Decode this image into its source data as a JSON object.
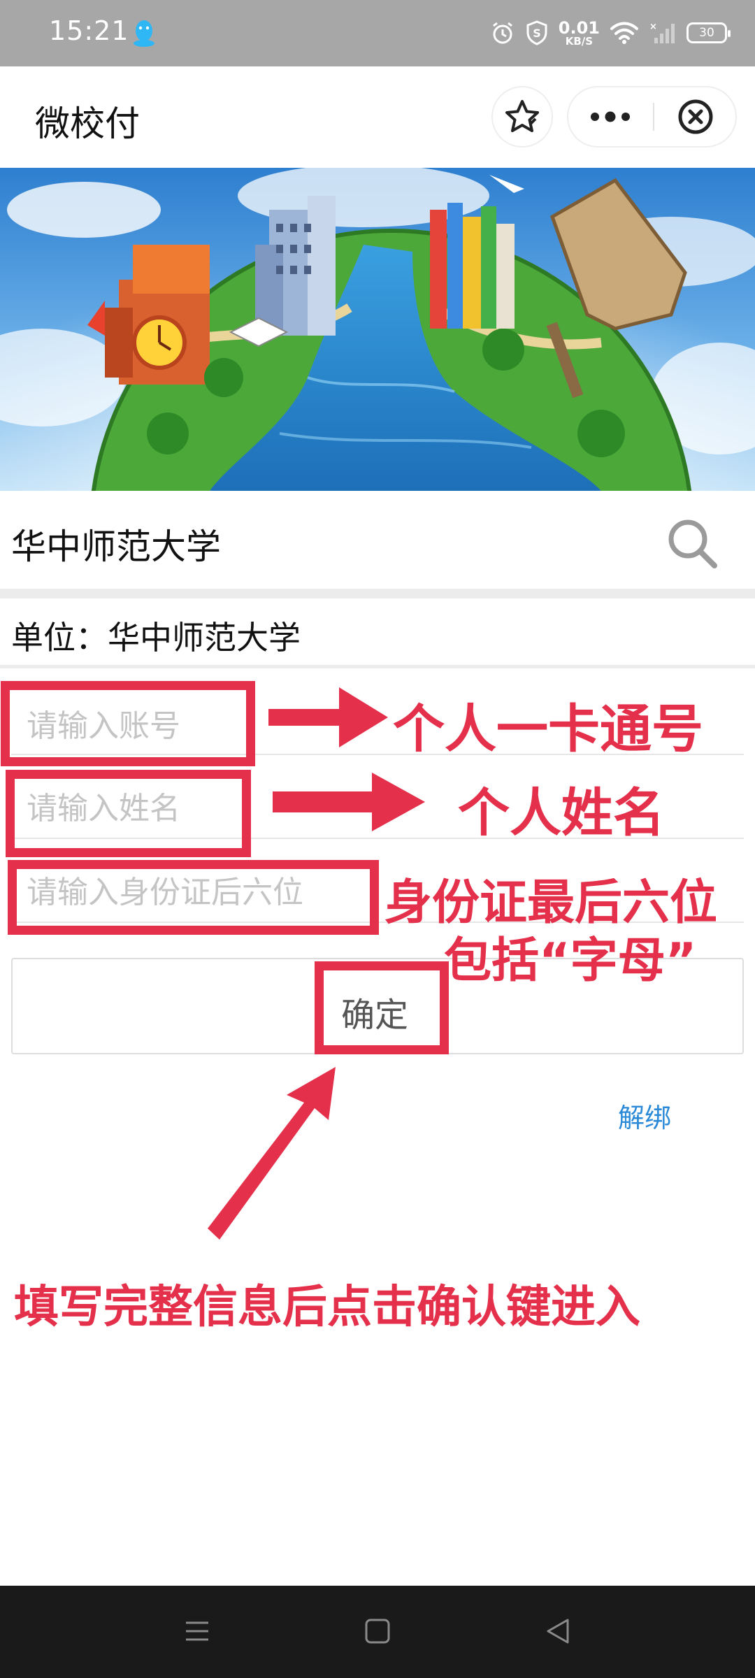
{
  "status_bar": {
    "time": "15:21",
    "net_speed": "0.01",
    "net_unit": "KB/S",
    "battery": "30",
    "icons": [
      "qq-icon",
      "alarm-icon",
      "shield-icon",
      "wifi-icon",
      "signal-icon",
      "battery-icon"
    ]
  },
  "title_bar": {
    "title": "微校付",
    "icons": [
      "star-icon",
      "more-icon",
      "close-circle-icon"
    ]
  },
  "school": {
    "name": "华中师范大学",
    "unit": "单位：华中师范大学"
  },
  "form": {
    "account_placeholder": "请输入账号",
    "name_placeholder": "请输入姓名",
    "id_placeholder": "请输入身份证后六位",
    "confirm_label": "确定",
    "unbind_label": "解绑"
  },
  "annotations": {
    "account_note": "个人一卡通号",
    "name_note": "个人姓名",
    "id_note_line1": "身份证最后六位",
    "id_note_line2": "包括“字母”",
    "bottom_note": "填写完整信息后点击确认键进入"
  },
  "colors": {
    "annotation_red": "#e5304b",
    "link_blue": "#2b8ad8",
    "status_bar_gray": "#a7a7a7",
    "nav_bar": "#1a1a1a"
  }
}
